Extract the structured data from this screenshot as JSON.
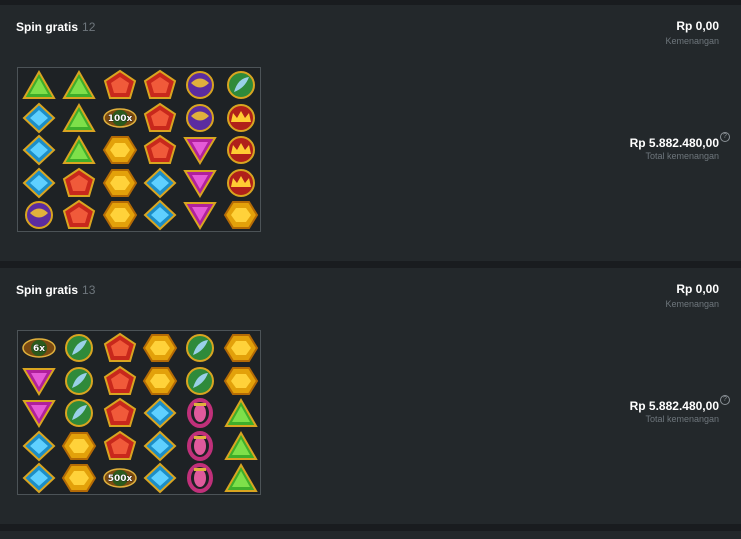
{
  "spins": [
    {
      "title": "Spin gratis",
      "number": "12",
      "win_amount": "Rp 0,00",
      "win_label": "Kemenangan",
      "total_amount": "Rp 5.882.480,00",
      "total_label": "Total kemenangan",
      "grid": [
        [
          "green-triangle-gem",
          "blue-diamond-gem",
          "blue-diamond-gem",
          "blue-diamond-gem",
          "purple-scarab-gem"
        ],
        [
          "green-triangle-gem",
          "green-triangle-gem",
          "green-triangle-gem",
          "red-pentagon-gem",
          "red-pentagon-gem"
        ],
        [
          "red-pentagon-gem",
          "multiplier-100x",
          "yellow-hexagon-gem",
          "yellow-hexagon-gem",
          "yellow-hexagon-gem"
        ],
        [
          "red-pentagon-gem",
          "red-pentagon-gem",
          "red-pentagon-gem",
          "blue-diamond-gem",
          "blue-diamond-gem"
        ],
        [
          "purple-scarab-gem",
          "purple-scarab-gem",
          "magenta-triangle-gem",
          "magenta-triangle-gem",
          "magenta-triangle-gem"
        ],
        [
          "green-feather-gem",
          "red-crown-gem",
          "red-crown-gem",
          "red-crown-gem",
          "yellow-hexagon-gem"
        ]
      ],
      "multipliers": {
        "multiplier-100x": "100x"
      }
    },
    {
      "title": "Spin gratis",
      "number": "13",
      "win_amount": "Rp 0,00",
      "win_label": "Kemenangan",
      "total_amount": "Rp 5.882.480,00",
      "total_label": "Total kemenangan",
      "grid": [
        [
          "multiplier-6x",
          "magenta-triangle-gem",
          "magenta-triangle-gem",
          "blue-diamond-gem",
          "blue-diamond-gem"
        ],
        [
          "green-feather-gem",
          "green-feather-gem",
          "green-feather-gem",
          "yellow-hexagon-gem",
          "yellow-hexagon-gem"
        ],
        [
          "red-pentagon-gem",
          "red-pentagon-gem",
          "red-pentagon-gem",
          "red-pentagon-gem",
          "multiplier-500x"
        ],
        [
          "yellow-hexagon-gem",
          "yellow-hexagon-gem",
          "blue-diamond-gem",
          "blue-diamond-gem",
          "blue-diamond-gem"
        ],
        [
          "green-feather-gem",
          "green-feather-gem",
          "pink-ring-gem",
          "pink-ring-gem",
          "pink-ring-gem"
        ],
        [
          "yellow-hexagon-gem",
          "yellow-hexagon-gem",
          "green-triangle-gem",
          "green-triangle-gem",
          "green-triangle-gem"
        ]
      ],
      "multipliers": {
        "multiplier-6x": "6x",
        "multiplier-500x": "500x"
      }
    }
  ],
  "colors": {
    "panel": "#23282b",
    "background": "#191c1f",
    "muted_text": "#6e767c",
    "grid_border": "#4c5357"
  }
}
